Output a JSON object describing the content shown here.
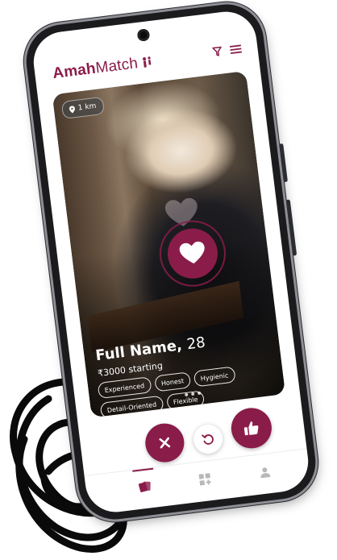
{
  "app": {
    "logo_bold": "Amah",
    "logo_light": "Match",
    "brand_color": "#8a1c4a"
  },
  "header": {
    "icons": [
      "filter-icon",
      "menu-icon"
    ]
  },
  "card": {
    "distance": "1 km",
    "name": "Full Name,",
    "age": "28",
    "price": "₹3000 starting",
    "tags": [
      "Experienced",
      "Honest",
      "Hygienic",
      "Detail-Oriented",
      "Flexible"
    ],
    "overlay_icon": "heart-icon"
  },
  "actions": {
    "reject_icon": "close-icon",
    "undo_icon": "undo-icon",
    "like_icon": "thumbs-up-icon"
  },
  "bottom_nav": {
    "items": [
      "cards-icon",
      "grid-icon",
      "profile-icon"
    ],
    "active_index": 0
  }
}
